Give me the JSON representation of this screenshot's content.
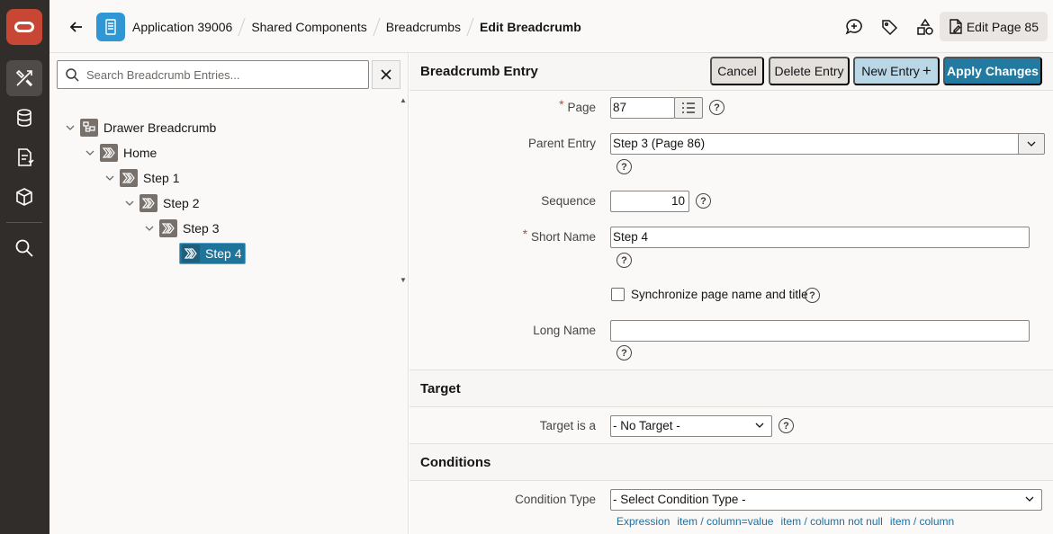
{
  "rail": {
    "items": [
      "app-builder",
      "sql-workshop",
      "team-development",
      "gallery",
      "search"
    ]
  },
  "topbar": {
    "breadcrumbs": [
      "Application 39006",
      "Shared Components",
      "Breadcrumbs",
      "Edit Breadcrumb"
    ],
    "edit_page_label": "Edit Page 85"
  },
  "tree": {
    "search_placeholder": "Search Breadcrumb Entries...",
    "nodes": [
      {
        "label": "Drawer Breadcrumb",
        "level": 0
      },
      {
        "label": "Home",
        "level": 1
      },
      {
        "label": "Step 1",
        "level": 2
      },
      {
        "label": "Step 2",
        "level": 3
      },
      {
        "label": "Step 3",
        "level": 4
      },
      {
        "label": "Step 4",
        "level": 5
      }
    ]
  },
  "entry": {
    "title": "Breadcrumb Entry",
    "buttons": {
      "cancel": "Cancel",
      "delete": "Delete Entry",
      "new": "New Entry",
      "new_icon": "+",
      "apply": "Apply Changes"
    },
    "fields": {
      "page_label": "Page",
      "page_value": "87",
      "parent_label": "Parent Entry",
      "parent_value": "Step 3 (Page 86)",
      "sequence_label": "Sequence",
      "sequence_value": "10",
      "short_name_label": "Short Name",
      "short_name_value": "Step 4",
      "sync_label": "Synchronize page name and title",
      "long_name_label": "Long Name",
      "long_name_value": ""
    },
    "required_mark": "*",
    "help_glyph": "?"
  },
  "target": {
    "title": "Target",
    "target_label": "Target is a",
    "target_value": "- No Target -"
  },
  "conditions": {
    "title": "Conditions",
    "condition_type_label": "Condition Type",
    "condition_type_value": "- Select Condition Type -",
    "quick_picks": [
      "Expression",
      "item / column=value",
      "item / column not null",
      "item / column"
    ]
  }
}
